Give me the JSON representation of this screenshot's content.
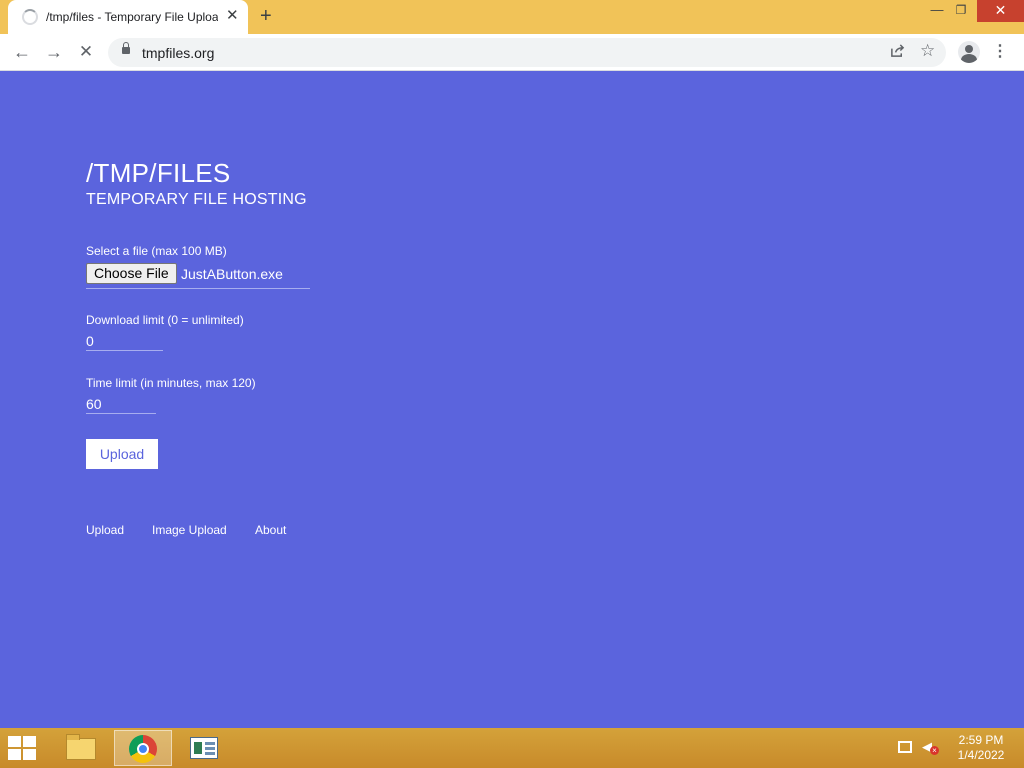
{
  "browser": {
    "tab_title": "/tmp/files - Temporary File Upload",
    "new_tab_label": "+",
    "url": "tmpfiles.org",
    "window_controls": {
      "minimize": "—",
      "maximize": "❐",
      "close": "✕"
    },
    "nav": {
      "back": "←",
      "forward": "→",
      "stop": "✕"
    },
    "icons": {
      "share": "share-icon",
      "bookmark": "star-icon",
      "menu": "⋮"
    }
  },
  "page": {
    "title": "/TMP/FILES",
    "subtitle": "TEMPORARY FILE HOSTING",
    "file_field": {
      "label": "Select a file (max 100 MB)",
      "button_label": "Choose File",
      "selected_file": "JustAButton.exe"
    },
    "download_limit": {
      "label": "Download limit (0 = unlimited)",
      "value": "0"
    },
    "time_limit": {
      "label": "Time limit (in minutes, max 120)",
      "value": "60"
    },
    "upload_button": "Upload",
    "footer_links": [
      "Upload",
      "Image Upload",
      "About"
    ],
    "colors": {
      "background": "#5b64dd",
      "text": "#ffffff"
    }
  },
  "taskbar": {
    "items": [
      "file-explorer",
      "google-chrome",
      "app"
    ],
    "active_item": "google-chrome",
    "clock": {
      "time": "2:59 PM",
      "date": "1/4/2022"
    }
  }
}
